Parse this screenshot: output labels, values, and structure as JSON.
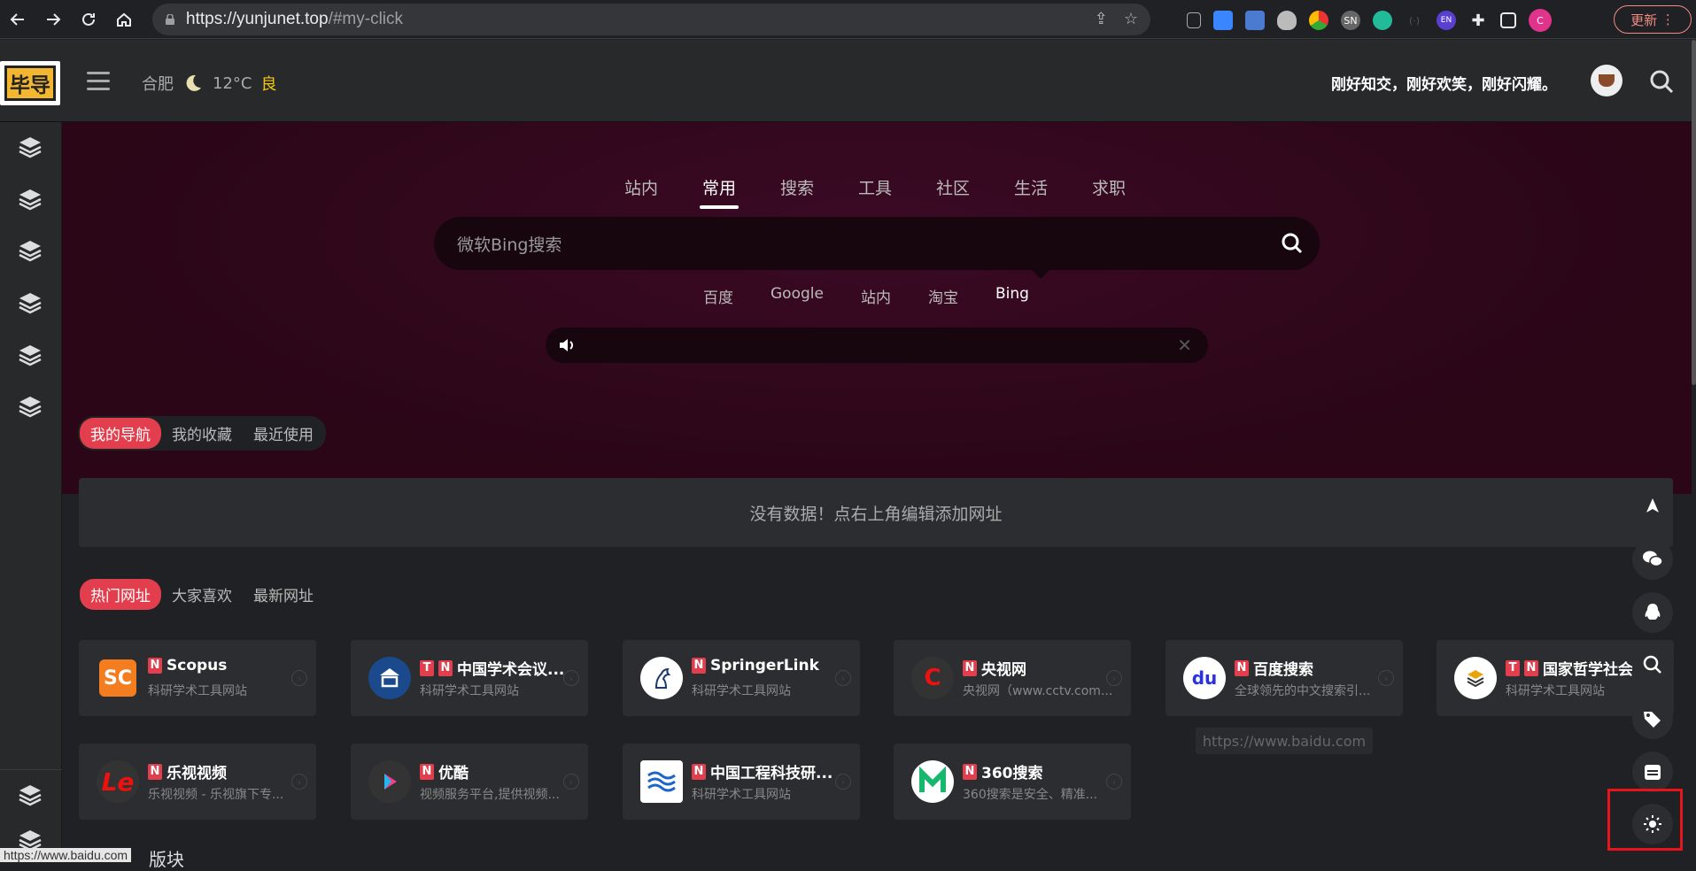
{
  "browser": {
    "url_host": "https://yunjunet.top",
    "url_path": "/#my-click",
    "update_label": "更新",
    "ext_labels": [
      "SN",
      "EN",
      "C"
    ]
  },
  "header": {
    "logo_text": "毕导",
    "weather": {
      "city": "合肥",
      "temp": "12°C",
      "aqi": "良"
    },
    "slogan": "刚好知交，刚好欢笑，刚好闪耀。"
  },
  "search": {
    "tabs": [
      "站内",
      "常用",
      "搜索",
      "工具",
      "社区",
      "生活",
      "求职"
    ],
    "active_tab": 1,
    "placeholder": "微软Bing搜索",
    "engines": [
      "百度",
      "Google",
      "站内",
      "淘宝",
      "Bing"
    ],
    "active_engine": 4
  },
  "nav_tabs": {
    "items": [
      "我的导航",
      "我的收藏",
      "最近使用"
    ],
    "empty_message": "没有数据！点右上角编辑添加网址"
  },
  "hot_tabs": {
    "items": [
      "热门网址",
      "大家喜欢",
      "最新网址"
    ]
  },
  "cards": [
    {
      "title": "Scopus",
      "desc": "科研学术工具网站",
      "badges": [
        "N"
      ],
      "icon_text": "SC",
      "icon_color": "#f47d20"
    },
    {
      "title": "中国学术会议...",
      "desc": "科研学术工具网站",
      "badges": [
        "T",
        "N"
      ],
      "icon_text": "",
      "icon_color": "#1b4a8c"
    },
    {
      "title": "SpringerLink",
      "desc": "科研学术工具网站",
      "badges": [
        "N"
      ],
      "icon_text": "",
      "icon_color": "#ffffff"
    },
    {
      "title": "央视网",
      "desc": "央视网（www.cctv.com...",
      "badges": [
        "N"
      ],
      "icon_text": "C",
      "icon_color": "#333333"
    },
    {
      "title": "百度搜索",
      "desc": "全球领先的中文搜索引...",
      "badges": [
        "N"
      ],
      "icon_text": "du",
      "icon_color": "#ffffff"
    },
    {
      "title": "国家哲学社会...",
      "desc": "科研学术工具网站",
      "badges": [
        "T",
        "N"
      ],
      "icon_text": "",
      "icon_color": "#ffffff"
    },
    {
      "title": "乐视视频",
      "desc": "乐视视频 - 乐视旗下专...",
      "badges": [
        "N"
      ],
      "icon_text": "Le",
      "icon_color": "#333333"
    },
    {
      "title": "优酷",
      "desc": "视频服务平台,提供视频...",
      "badges": [
        "N"
      ],
      "icon_text": "",
      "icon_color": "#333333"
    },
    {
      "title": "中国工程科技研...",
      "desc": "科研学术工具网站",
      "badges": [
        "N"
      ],
      "icon_text": "",
      "icon_color": "#ffffff"
    },
    {
      "title": "360搜索",
      "desc": "360搜索是安全、精准...",
      "badges": [
        "N"
      ],
      "icon_text": "",
      "icon_color": "#ffffff"
    }
  ],
  "tooltip": "https://www.baidu.com",
  "statusbar": "https://www.baidu.com",
  "section_title_partial": "版块",
  "colors": {
    "accent": "#e33e4d",
    "highlight": "#e8131b",
    "aqi": "#f3c613"
  }
}
